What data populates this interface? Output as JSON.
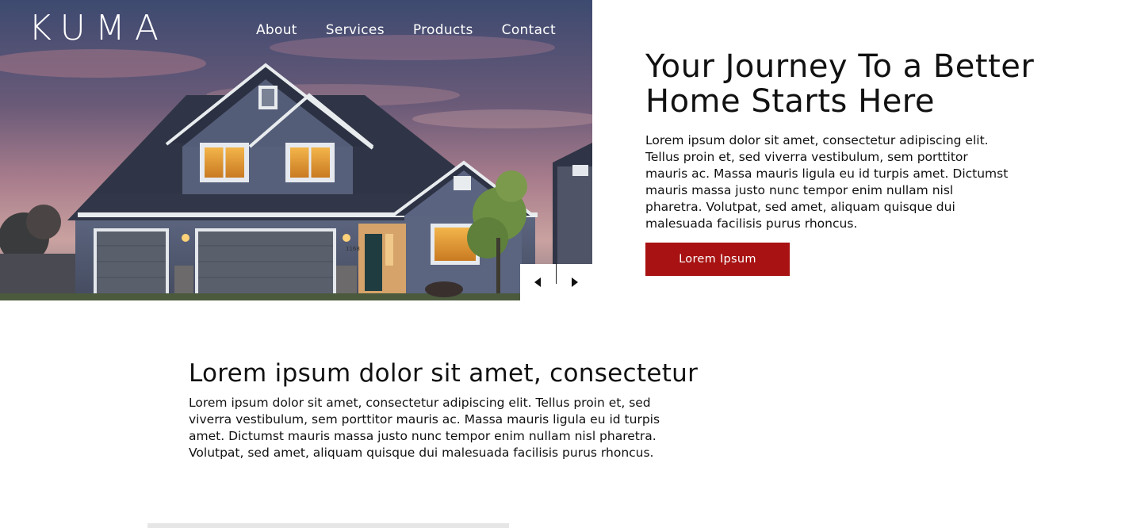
{
  "brand": {
    "logo_text": "KUMA"
  },
  "nav": {
    "items": [
      "About",
      "Services",
      "Products",
      "Contact"
    ]
  },
  "hero": {
    "title": "Your Journey To a Better Home Starts Here",
    "body": "Lorem ipsum dolor sit amet, consectetur adipiscing elit. Tellus proin et, sed viverra vestibulum, sem porttitor mauris ac. Massa mauris ligula eu id turpis amet. Dictumst mauris massa justo nunc tempor enim nullam nisl pharetra. Volutpat, sed amet, aliquam quisque dui malesuada facilisis purus rhoncus.",
    "cta_label": "Lorem Ipsum",
    "house_number": "1168"
  },
  "slider": {
    "prev_icon": "arrow-left-icon",
    "next_icon": "arrow-right-icon"
  },
  "section2": {
    "title": "Lorem ipsum dolor sit amet, consectetur",
    "body": "Lorem ipsum dolor sit amet, consectetur adipiscing elit. Tellus proin et, sed viverra vestibulum, sem porttitor mauris ac. Massa mauris ligula eu id turpis amet. Dictumst mauris massa justo nunc tempor enim nullam nisl pharetra. Volutpat, sed amet, aliquam quisque dui malesuada facilisis purus rhoncus."
  },
  "colors": {
    "accent": "#a81212",
    "nav_text": "#ffffff",
    "body_text": "#111111"
  }
}
